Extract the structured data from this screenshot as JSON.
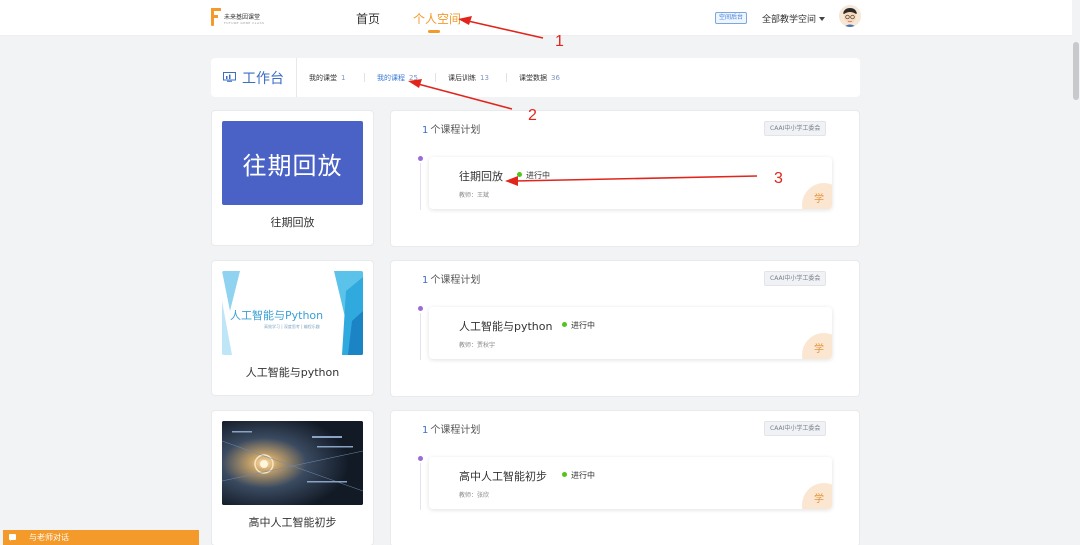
{
  "header": {
    "logo_text": "未来基因课堂",
    "logo_sub": "FUTURE GENE CLASS",
    "nav": [
      {
        "label": "首页"
      },
      {
        "label": "个人空间"
      }
    ],
    "admin_badge": "空间后台",
    "space_select": "全部教学空间",
    "accent_color": "#f39a2b"
  },
  "workbench": {
    "title": "工作台",
    "tabs": [
      {
        "label": "我的课堂",
        "count": "1"
      },
      {
        "label": "我的课程",
        "count": "25"
      },
      {
        "label": "课后训练",
        "count": "13"
      },
      {
        "label": "课堂数据",
        "count": "36"
      }
    ]
  },
  "courses": [
    {
      "thumb_text": "往期回放",
      "name": "往期回放",
      "plan_count": "1",
      "plan_label": "个课程计划",
      "org": "CAAI中小学工委会",
      "plan_name": "往期回放",
      "status": "进行中",
      "teacher": "教师：王斌",
      "corner": "学"
    },
    {
      "thumb_text": "人工智能与Python",
      "thumb_sub": "高效学习 | 深度思考 | 编程乐趣",
      "name": "人工智能与python",
      "plan_count": "1",
      "plan_label": "个课程计划",
      "org": "CAAI中小学工委会",
      "plan_name": "人工智能与python",
      "status": "进行中",
      "teacher": "教师：贾秋宇",
      "corner": "学"
    },
    {
      "name": "高中人工智能初步",
      "plan_count": "1",
      "plan_label": "个课程计划",
      "org": "CAAI中小学工委会",
      "plan_name": "高中人工智能初步",
      "status": "进行中",
      "teacher": "教师：张欣",
      "corner": "学"
    }
  ],
  "annotations": [
    "1",
    "2",
    "3"
  ],
  "chat": {
    "label": "与老师对话"
  }
}
